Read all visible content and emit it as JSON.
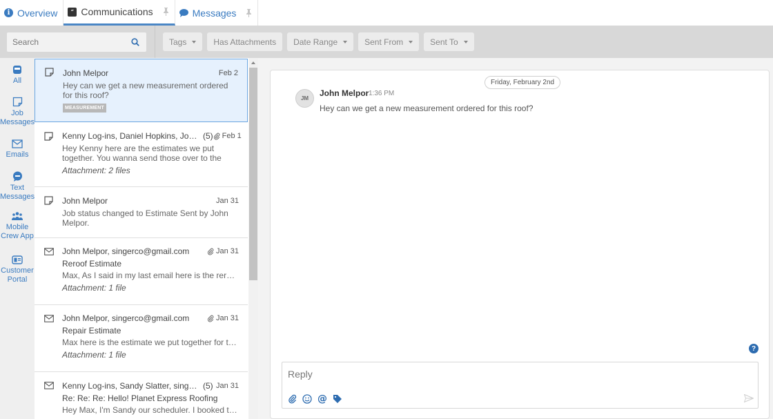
{
  "tabs": [
    {
      "label": "Overview",
      "icon": "info-icon",
      "active": false,
      "pinned": false
    },
    {
      "label": "Communications",
      "icon": "quote-icon",
      "active": true,
      "pinned": true
    },
    {
      "label": "Messages",
      "icon": "chat-icon",
      "active": false,
      "pinned": true
    }
  ],
  "search": {
    "placeholder": "Search"
  },
  "filters": [
    {
      "label": "Tags",
      "dropdown": true
    },
    {
      "label": "Has Attachments",
      "dropdown": false
    },
    {
      "label": "Date Range",
      "dropdown": true
    },
    {
      "label": "Sent From",
      "dropdown": true
    },
    {
      "label": "Sent To",
      "dropdown": true
    }
  ],
  "nav": [
    {
      "label": "All",
      "icon": "inbox-icon",
      "active": true
    },
    {
      "label": "Job Messages",
      "icon": "note-icon"
    },
    {
      "label": "Emails",
      "icon": "envelope-icon"
    },
    {
      "label": "Text Messages",
      "icon": "text-bubble-icon"
    },
    {
      "label": "Mobile Crew App",
      "icon": "crew-icon"
    },
    {
      "label": "Customer Portal",
      "icon": "portal-icon"
    }
  ],
  "messages": [
    {
      "type": "note",
      "from": "John Melpor",
      "count": "",
      "attachment": false,
      "date": "Feb 2",
      "subject": "",
      "preview": "Hey can we get a new measurement ordered for this roof?",
      "attachments": "",
      "tag": "MEASUREMENT",
      "selected": true
    },
    {
      "type": "note",
      "from": "Kenny Log-ins, Daniel Hopkins, Joh...",
      "count": "(5)",
      "attachment": true,
      "date": "Feb 1",
      "subject": "",
      "preview": "Hey Kenny here are the estimates we put together. You wanna send those over to the HO? Remembe...",
      "attachments": "Attachment: 2 files",
      "tag": ""
    },
    {
      "type": "note",
      "from": "John Melpor",
      "count": "",
      "attachment": false,
      "date": "Jan 31",
      "subject": "",
      "preview": "Job status changed to Estimate Sent by John Melpor.",
      "attachments": "",
      "tag": ""
    },
    {
      "type": "email",
      "from": "John Melpor, singerco@gmail.com",
      "count": "",
      "attachment": true,
      "date": "Jan 31",
      "subject": "Reroof Estimate",
      "preview": "Max, As I said in my last email here is the reroof...",
      "attachments": "Attachment: 1 file",
      "tag": ""
    },
    {
      "type": "email",
      "from": "John Melpor, singerco@gmail.com",
      "count": "",
      "attachment": true,
      "date": "Jan 31",
      "subject": "Repair Estimate",
      "preview": "Max here is the estimate we put together for the...",
      "attachments": "Attachment: 1 file",
      "tag": ""
    },
    {
      "type": "email",
      "from": "Kenny Log-ins, Sandy Slatter, singerco...",
      "count": "(5)",
      "attachment": false,
      "date": "Jan 31",
      "subject": "Re: Re: Re: Hello! Planet Express Roofing",
      "preview": "Hey Max, I'm Sandy our scheduler. I booked that...",
      "attachments": "",
      "tag": ""
    }
  ],
  "conversation": {
    "date_label": "Friday, February 2nd",
    "avatar_initials": "JM",
    "author": "John Melpor",
    "time": "1:36 PM",
    "body": "Hey can we get a new measurement ordered for this roof?"
  },
  "reply": {
    "placeholder": "Reply"
  },
  "colors": {
    "accent": "#3a7bc0",
    "selected_bg": "#e6f1fd",
    "filter_bar": "#d8d8d8"
  }
}
